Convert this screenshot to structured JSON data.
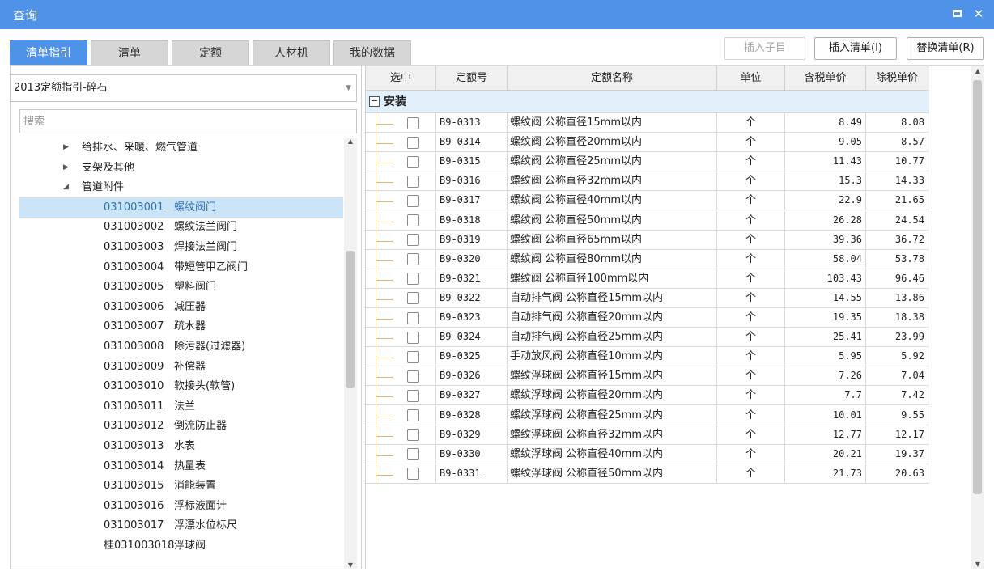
{
  "window": {
    "title": "查询"
  },
  "tabs": [
    {
      "label": "清单指引",
      "active": true
    },
    {
      "label": "清单",
      "active": false
    },
    {
      "label": "定额",
      "active": false
    },
    {
      "label": "人材机",
      "active": false
    },
    {
      "label": "我的数据",
      "active": false
    }
  ],
  "actions": {
    "insert_child": "插入子目",
    "insert_list": "插入清单(I)",
    "replace_list": "替换清单(R)"
  },
  "left": {
    "dropdown_value": "2013定额指引-碎石",
    "search_placeholder": "搜索",
    "tree": [
      {
        "kind": "folder",
        "label": "给排水、采暖、燃气管道",
        "expanded": false
      },
      {
        "kind": "folder",
        "label": "支架及其他",
        "expanded": false
      },
      {
        "kind": "folder",
        "label": "管道附件",
        "expanded": true
      },
      {
        "kind": "item",
        "code": "031003001",
        "name": "螺纹阀门",
        "selected": true
      },
      {
        "kind": "item",
        "code": "031003002",
        "name": "螺纹法兰阀门"
      },
      {
        "kind": "item",
        "code": "031003003",
        "name": "焊接法兰阀门"
      },
      {
        "kind": "item",
        "code": "031003004",
        "name": "带短管甲乙阀门"
      },
      {
        "kind": "item",
        "code": "031003005",
        "name": "塑料阀门"
      },
      {
        "kind": "item",
        "code": "031003006",
        "name": "减压器"
      },
      {
        "kind": "item",
        "code": "031003007",
        "name": "疏水器"
      },
      {
        "kind": "item",
        "code": "031003008",
        "name": "除污器(过滤器)"
      },
      {
        "kind": "item",
        "code": "031003009",
        "name": "补偿器"
      },
      {
        "kind": "item",
        "code": "031003010",
        "name": "软接头(软管)"
      },
      {
        "kind": "item",
        "code": "031003011",
        "name": "法兰"
      },
      {
        "kind": "item",
        "code": "031003012",
        "name": "倒流防止器"
      },
      {
        "kind": "item",
        "code": "031003013",
        "name": "水表"
      },
      {
        "kind": "item",
        "code": "031003014",
        "name": "热量表"
      },
      {
        "kind": "item",
        "code": "031003015",
        "name": "消能装置"
      },
      {
        "kind": "item",
        "code": "031003016",
        "name": "浮标液面计"
      },
      {
        "kind": "item",
        "code": "031003017",
        "name": "浮漂水位标尺"
      },
      {
        "kind": "item",
        "code": "桂031003018",
        "name": "浮球阀"
      }
    ]
  },
  "grid": {
    "headers": {
      "select": "选中",
      "code": "定额号",
      "name": "定额名称",
      "unit": "单位",
      "price_tax": "含税单价",
      "price_notax": "除税单价"
    },
    "group": {
      "toggle": "−",
      "label": "安装"
    },
    "rows": [
      {
        "code": "B9-0313",
        "name": "螺纹阀 公称直径15mm以内",
        "unit": "个",
        "price_tax": "8.49",
        "price_notax": "8.08"
      },
      {
        "code": "B9-0314",
        "name": "螺纹阀 公称直径20mm以内",
        "unit": "个",
        "price_tax": "9.05",
        "price_notax": "8.57"
      },
      {
        "code": "B9-0315",
        "name": "螺纹阀 公称直径25mm以内",
        "unit": "个",
        "price_tax": "11.43",
        "price_notax": "10.77"
      },
      {
        "code": "B9-0316",
        "name": "螺纹阀 公称直径32mm以内",
        "unit": "个",
        "price_tax": "15.3",
        "price_notax": "14.33"
      },
      {
        "code": "B9-0317",
        "name": "螺纹阀 公称直径40mm以内",
        "unit": "个",
        "price_tax": "22.9",
        "price_notax": "21.65"
      },
      {
        "code": "B9-0318",
        "name": "螺纹阀 公称直径50mm以内",
        "unit": "个",
        "price_tax": "26.28",
        "price_notax": "24.54"
      },
      {
        "code": "B9-0319",
        "name": "螺纹阀 公称直径65mm以内",
        "unit": "个",
        "price_tax": "39.36",
        "price_notax": "36.72"
      },
      {
        "code": "B9-0320",
        "name": "螺纹阀 公称直径80mm以内",
        "unit": "个",
        "price_tax": "58.04",
        "price_notax": "53.78"
      },
      {
        "code": "B9-0321",
        "name": "螺纹阀 公称直径100mm以内",
        "unit": "个",
        "price_tax": "103.43",
        "price_notax": "96.46"
      },
      {
        "code": "B9-0322",
        "name": "自动排气阀 公称直径15mm以内",
        "unit": "个",
        "price_tax": "14.55",
        "price_notax": "13.86"
      },
      {
        "code": "B9-0323",
        "name": "自动排气阀 公称直径20mm以内",
        "unit": "个",
        "price_tax": "19.35",
        "price_notax": "18.38"
      },
      {
        "code": "B9-0324",
        "name": "自动排气阀 公称直径25mm以内",
        "unit": "个",
        "price_tax": "25.41",
        "price_notax": "23.99"
      },
      {
        "code": "B9-0325",
        "name": "手动放风阀 公称直径10mm以内",
        "unit": "个",
        "price_tax": "5.95",
        "price_notax": "5.92"
      },
      {
        "code": "B9-0326",
        "name": "螺纹浮球阀 公称直径15mm以内",
        "unit": "个",
        "price_tax": "7.26",
        "price_notax": "7.04"
      },
      {
        "code": "B9-0327",
        "name": "螺纹浮球阀 公称直径20mm以内",
        "unit": "个",
        "price_tax": "7.7",
        "price_notax": "7.42"
      },
      {
        "code": "B9-0328",
        "name": "螺纹浮球阀 公称直径25mm以内",
        "unit": "个",
        "price_tax": "10.01",
        "price_notax": "9.55"
      },
      {
        "code": "B9-0329",
        "name": "螺纹浮球阀 公称直径32mm以内",
        "unit": "个",
        "price_tax": "12.77",
        "price_notax": "12.17"
      },
      {
        "code": "B9-0330",
        "name": "螺纹浮球阀 公称直径40mm以内",
        "unit": "个",
        "price_tax": "20.21",
        "price_notax": "19.37"
      },
      {
        "code": "B9-0331",
        "name": "螺纹浮球阀 公称直径50mm以内",
        "unit": "个",
        "price_tax": "21.73",
        "price_notax": "20.63"
      }
    ]
  },
  "colors": {
    "accent": "#4f93e8",
    "selected_row": "#cce4f7",
    "group_row": "#e1f0fb"
  }
}
